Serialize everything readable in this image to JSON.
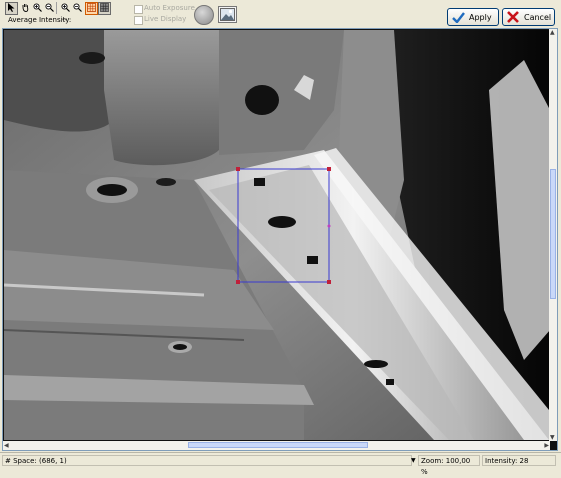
{
  "toolbar": {
    "tools": [
      {
        "icon": "pointer-icon"
      },
      {
        "icon": "hand-icon"
      },
      {
        "icon": "zoom-in-icon"
      },
      {
        "icon": "zoom-out-icon"
      },
      {
        "icon": "zoom-area-icon"
      },
      {
        "icon": "zoom-in-2-icon"
      },
      {
        "icon": "zoom-out-2-icon"
      },
      {
        "icon": "grid-icon"
      },
      {
        "icon": "grid-fill-icon"
      }
    ],
    "average_intensity_label": "Average Intensity:",
    "average_intensity_value": "--",
    "auto_exposure_label": "Auto Exposure",
    "live_display_label": "Live Display",
    "apply_label": "Apply",
    "cancel_label": "Cancel"
  },
  "status": {
    "space": "# Space: (686, 1)",
    "zoom": "Zoom: 100,00 %",
    "intensity": "Intensity: 28"
  },
  "colors": {
    "roi_border": "#3a3ad0",
    "roi_handle": "#c0203a",
    "apply_check": "#1f6bbf",
    "cancel_x": "#c8141a"
  }
}
